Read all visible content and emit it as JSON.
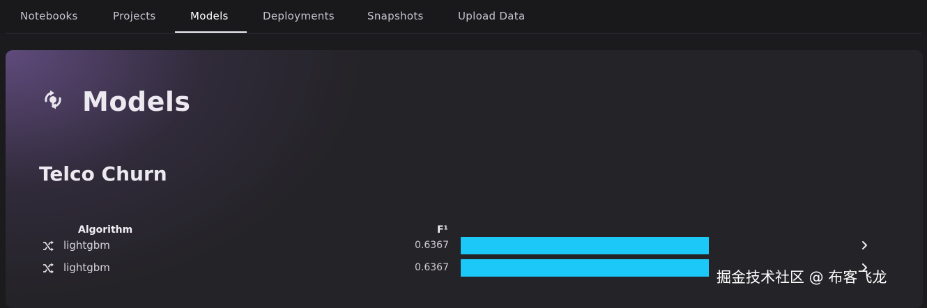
{
  "nav": {
    "tabs": [
      {
        "label": "Notebooks",
        "active": false
      },
      {
        "label": "Projects",
        "active": false
      },
      {
        "label": "Models",
        "active": true
      },
      {
        "label": "Deployments",
        "active": false
      },
      {
        "label": "Snapshots",
        "active": false
      },
      {
        "label": "Upload Data",
        "active": false
      }
    ]
  },
  "page": {
    "title": "Models",
    "icon": "models-cycle-icon"
  },
  "project": {
    "title": "Telco Churn"
  },
  "table": {
    "columns": {
      "algorithm": "Algorithm",
      "metric": "F¹"
    },
    "rows": [
      {
        "algorithm": "lightgbm",
        "score": "0.6367",
        "score_fraction": 0.6367,
        "icon": "shuffle-icon"
      },
      {
        "algorithm": "lightgbm",
        "score": "0.6367",
        "score_fraction": 0.6367,
        "icon": "shuffle-icon"
      }
    ]
  },
  "watermark": "掘金技术社区 @ 布客飞龙",
  "colors": {
    "bar": "#1cc8f8",
    "accent_gradient": "#6a528c",
    "background": "#1b1a1d"
  }
}
